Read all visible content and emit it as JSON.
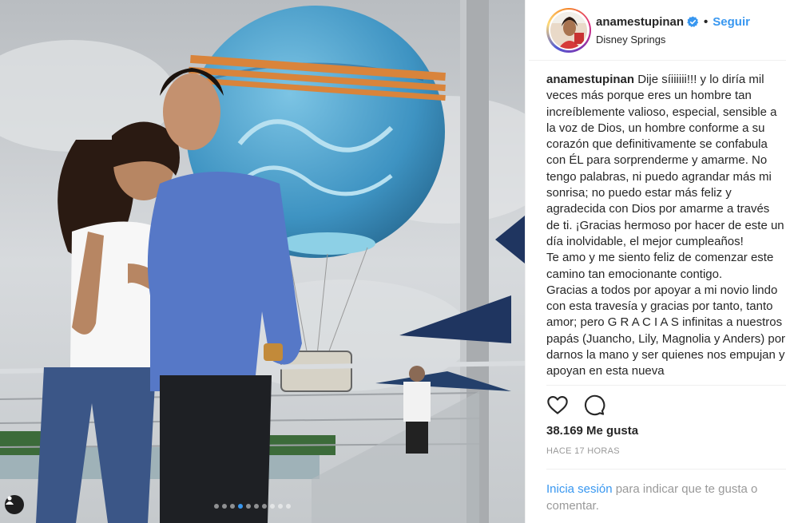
{
  "post": {
    "username": "anamestupinan",
    "verified": true,
    "separator": "•",
    "follow_label": "Seguir",
    "location": "Disney Springs"
  },
  "caption": {
    "author": "anamestupinan",
    "text": "Dije síiiiiii!!! y lo diría mil veces más porque eres un hombre tan increíblemente valioso, especial, sensible a la voz de Dios, un hombre conforme a su corazón que definitivamente se confabula con ÉL para sorprenderme y amarme. No tengo palabras, ni puedo agrandar más mi sonrisa; no puedo estar más feliz y agradecida con Dios por amarme a través de ti. ¡Gracias hermoso por hacer de este un día inolvidable, el mejor cumpleaños!",
    "paragraph2": "Te amo y me siento feliz de comenzar este camino tan emocionante contigo.",
    "paragraph3": "Gracias a todos por apoyar a mi novio lindo con esta travesía y gracias por tanto, tanto amor; pero G R A C I A S infinitas a nuestros papás (Juancho, Lily, Magnolia y Anders) por darnos la mano y ser quienes nos empujan y apoyan en esta nueva"
  },
  "stats": {
    "likes": "38.169 Me gusta",
    "time": "HACE 17 HORAS"
  },
  "login_prompt": {
    "link": "Inicia sesión",
    "text": " para indicar que te gusta o comentar."
  },
  "icons": {
    "like": "heart-icon",
    "comment": "comment-icon",
    "verified": "verified-badge-icon",
    "tag": "user-tag-icon"
  },
  "carousel": {
    "total": 10,
    "active_index": 3
  },
  "colors": {
    "accent": "#3897f0",
    "muted": "#999999",
    "border": "#efefef"
  }
}
